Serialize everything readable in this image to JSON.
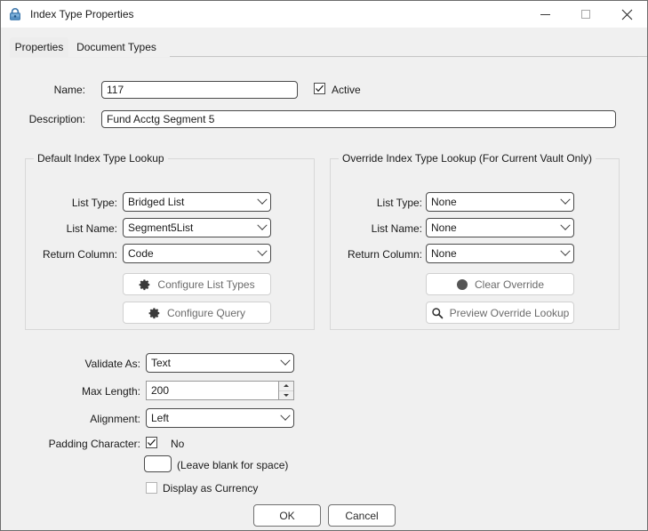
{
  "window": {
    "title": "Index Type Properties",
    "icon": "lock-icon",
    "icon_color": "#2f6fa8",
    "background": "#f0f0f0",
    "controls": {
      "minimize": "minimize-icon",
      "maximize": "maximize-icon",
      "close": "close-icon"
    }
  },
  "tabs": [
    {
      "label": "Properties",
      "selected": true
    },
    {
      "label": "Document Types",
      "selected": false
    }
  ],
  "form": {
    "name_label": "Name:",
    "name_value": "117",
    "active_label": "Active",
    "active_checked": true,
    "description_label": "Description:",
    "description_value": "Fund Acctg Segment 5"
  },
  "default_group": {
    "title": "Default Index Type Lookup",
    "list_type_label": "List Type:",
    "list_type_value": "Bridged List",
    "list_name_label": "List Name:",
    "list_name_value": "Segment5List",
    "return_column_label": "Return Column:",
    "return_column_value": "Code",
    "configure_list_types_button": "Configure List Types",
    "configure_list_types_icon": "gear-icon",
    "configure_query_button": "Configure Query",
    "configure_query_icon": "gear-icon"
  },
  "override_group": {
    "title": "Override Index Type Lookup (For Current Vault Only)",
    "list_type_label": "List Type:",
    "list_type_value": "None",
    "list_name_label": "List Name:",
    "list_name_value": "None",
    "return_column_label": "Return Column:",
    "return_column_value": "None",
    "clear_override_button": "Clear Override",
    "clear_override_icon": "circle-icon",
    "preview_override_button": "Preview Override Lookup",
    "preview_override_icon": "magnifier-icon"
  },
  "settings": {
    "validate_as_label": "Validate As:",
    "validate_as_value": "Text",
    "max_length_label": "Max Length:",
    "max_length_value": "200",
    "alignment_label": "Alignment:",
    "alignment_value": "Left",
    "padding_character_label": "Padding Character:",
    "padding_no_label": "No",
    "padding_no_checked": true,
    "padding_char_value": "",
    "padding_hint": "(Leave blank for space)",
    "display_as_currency_label": "Display as Currency",
    "display_as_currency_checked": false
  },
  "footer": {
    "ok_label": "OK",
    "cancel_label": "Cancel"
  }
}
